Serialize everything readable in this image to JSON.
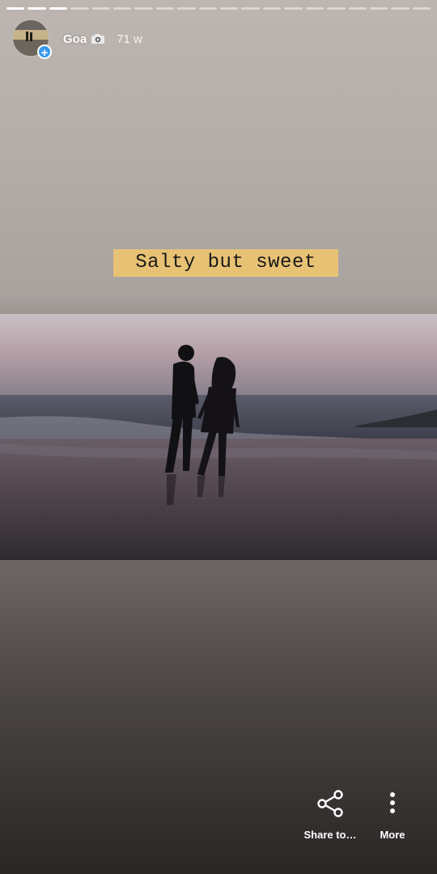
{
  "story": {
    "user": "Goa",
    "timestamp": "71 w",
    "segments_total": 20,
    "segments_done": 3
  },
  "caption": {
    "text": "Salty but sweet",
    "bg": "#e8c274"
  },
  "actions": {
    "share_label": "Share to…",
    "more_label": "More",
    "share_icon": "share-icon",
    "more_icon": "more-vertical-icon"
  },
  "colors": {
    "accent": "#3897f0"
  }
}
